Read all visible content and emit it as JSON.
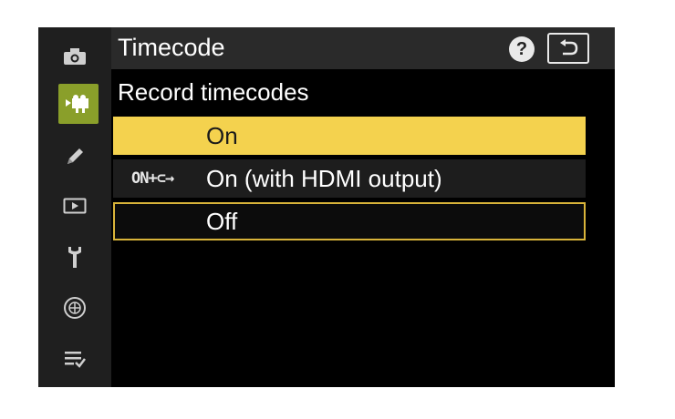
{
  "header": {
    "title": "Timecode"
  },
  "section": {
    "subtitle": "Record timecodes"
  },
  "options": [
    {
      "label": "On",
      "state": "highlighted"
    },
    {
      "label": "On (with HDMI output)",
      "badge": "ON+⊂→"
    },
    {
      "label": "Off",
      "state": "current"
    }
  ],
  "help_symbol": "?",
  "sidebar": {
    "items": [
      {
        "icon": "camera-icon"
      },
      {
        "icon": "movie-camera-icon",
        "active": true
      },
      {
        "icon": "pencil-icon"
      },
      {
        "icon": "playback-icon"
      },
      {
        "icon": "wrench-icon"
      },
      {
        "icon": "network-icon"
      },
      {
        "icon": "my-menu-icon"
      }
    ]
  },
  "colors": {
    "highlight": "#f4d24e",
    "active_tab": "#8a9f2a",
    "current_outline": "#d9b43a"
  }
}
